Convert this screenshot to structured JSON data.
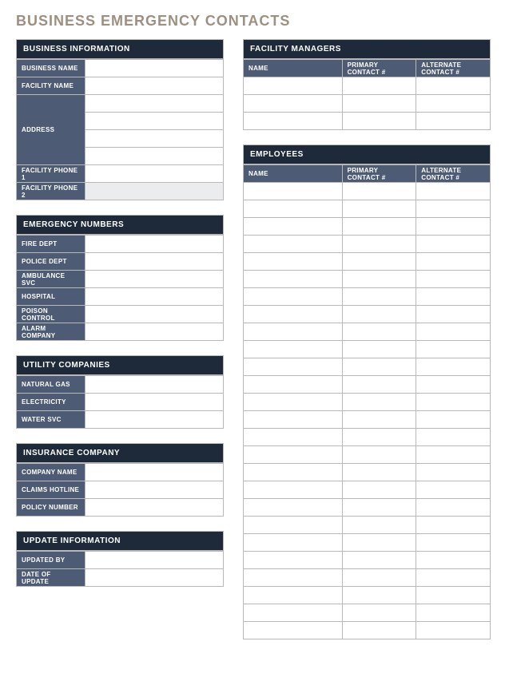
{
  "title": "BUSINESS EMERGENCY CONTACTS",
  "businessInfo": {
    "header": "BUSINESS INFORMATION",
    "labels": {
      "businessName": "BUSINESS NAME",
      "facilityName": "FACILITY NAME",
      "address": "ADDRESS",
      "facilityPhone1": "FACILITY PHONE 1",
      "facilityPhone2": "FACILITY PHONE 2"
    },
    "values": {
      "businessName": "",
      "facilityName": "",
      "address1": "",
      "address2": "",
      "address3": "",
      "address4": "",
      "facilityPhone1": "",
      "facilityPhone2": ""
    }
  },
  "emergencyNumbers": {
    "header": "EMERGENCY NUMBERS",
    "rows": [
      {
        "label": "FIRE DEPT",
        "value": ""
      },
      {
        "label": "POLICE DEPT",
        "value": ""
      },
      {
        "label": "AMBULANCE SVC",
        "value": ""
      },
      {
        "label": "HOSPITAL",
        "value": ""
      },
      {
        "label": "POISON CONTROL",
        "value": ""
      },
      {
        "label": "ALARM COMPANY",
        "value": ""
      }
    ]
  },
  "utilityCompanies": {
    "header": "UTILITY COMPANIES",
    "rows": [
      {
        "label": "NATURAL GAS",
        "value": ""
      },
      {
        "label": "ELECTRICITY",
        "value": ""
      },
      {
        "label": "WATER SVC",
        "value": ""
      }
    ]
  },
  "insuranceCompany": {
    "header": "INSURANCE COMPANY",
    "rows": [
      {
        "label": "COMPANY NAME",
        "value": ""
      },
      {
        "label": "CLAIMS HOTLINE",
        "value": ""
      },
      {
        "label": "POLICY NUMBER",
        "value": ""
      }
    ]
  },
  "updateInformation": {
    "header": "UPDATE INFORMATION",
    "rows": [
      {
        "label": "UPDATED BY",
        "value": ""
      },
      {
        "label": "DATE OF UPDATE",
        "value": ""
      }
    ]
  },
  "facilityManagers": {
    "header": "FACILITY MANAGERS",
    "columns": {
      "name": "NAME",
      "primary": "PRIMARY CONTACT #",
      "alternate": "ALTERNATE CONTACT #"
    },
    "rows": [
      {
        "name": "",
        "primary": "",
        "alternate": ""
      },
      {
        "name": "",
        "primary": "",
        "alternate": ""
      },
      {
        "name": "",
        "primary": "",
        "alternate": ""
      }
    ]
  },
  "employees": {
    "header": "EMPLOYEES",
    "columns": {
      "name": "NAME",
      "primary": "PRIMARY CONTACT #",
      "alternate": "ALTERNATE CONTACT #"
    },
    "rows": [
      {
        "name": "",
        "primary": "",
        "alternate": ""
      },
      {
        "name": "",
        "primary": "",
        "alternate": ""
      },
      {
        "name": "",
        "primary": "",
        "alternate": ""
      },
      {
        "name": "",
        "primary": "",
        "alternate": ""
      },
      {
        "name": "",
        "primary": "",
        "alternate": ""
      },
      {
        "name": "",
        "primary": "",
        "alternate": ""
      },
      {
        "name": "",
        "primary": "",
        "alternate": ""
      },
      {
        "name": "",
        "primary": "",
        "alternate": ""
      },
      {
        "name": "",
        "primary": "",
        "alternate": ""
      },
      {
        "name": "",
        "primary": "",
        "alternate": ""
      },
      {
        "name": "",
        "primary": "",
        "alternate": ""
      },
      {
        "name": "",
        "primary": "",
        "alternate": ""
      },
      {
        "name": "",
        "primary": "",
        "alternate": ""
      },
      {
        "name": "",
        "primary": "",
        "alternate": ""
      },
      {
        "name": "",
        "primary": "",
        "alternate": ""
      },
      {
        "name": "",
        "primary": "",
        "alternate": ""
      },
      {
        "name": "",
        "primary": "",
        "alternate": ""
      },
      {
        "name": "",
        "primary": "",
        "alternate": ""
      },
      {
        "name": "",
        "primary": "",
        "alternate": ""
      },
      {
        "name": "",
        "primary": "",
        "alternate": ""
      },
      {
        "name": "",
        "primary": "",
        "alternate": ""
      },
      {
        "name": "",
        "primary": "",
        "alternate": ""
      },
      {
        "name": "",
        "primary": "",
        "alternate": ""
      },
      {
        "name": "",
        "primary": "",
        "alternate": ""
      },
      {
        "name": "",
        "primary": "",
        "alternate": ""
      },
      {
        "name": "",
        "primary": "",
        "alternate": ""
      }
    ]
  }
}
